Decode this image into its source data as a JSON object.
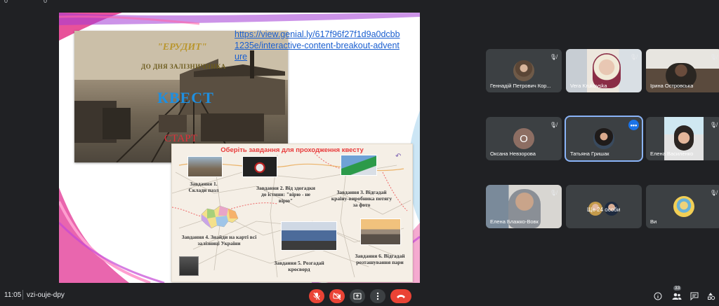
{
  "top": {
    "a": "0",
    "b": "0"
  },
  "slide": {
    "photo_title": "\"ЕРУДИТ\"",
    "photo_subtitle": "ДО ДНЯ ЗАЛІЗНИЧНИКА",
    "photo_quest": "КВЕСТ",
    "photo_start": "СТАРТ",
    "link": "https://view.genial.ly/617f96f27f1d9a0dcbb1235e/interactive-content-breakout-adventure",
    "map_title": "Оберіть завдання для проходження квесту",
    "tasks": [
      "Завдання 1. Склади пазл",
      "Завдання 2. Від здогадки до істини: \"вірю - не вірю\"",
      "Завдання 3. Відгадай країну-виробника потягу за фото",
      "Завдання 4. Знайди на карті всі залізниці України",
      "Завдання 5. Розгадай кросворд",
      "Завдання 6. Відгадай розташування пари"
    ]
  },
  "participants": [
    {
      "name": "Геннадій Петрович Кор...",
      "mic": "muted"
    },
    {
      "name": "Vera Krukovska",
      "mic": "muted"
    },
    {
      "name": "Ірина Островська",
      "mic": "muted"
    },
    {
      "name": "Оксана Невзорова",
      "initial": "О",
      "mic": "muted"
    },
    {
      "name": "Татьяна Гришак",
      "mic": "more"
    },
    {
      "name": "Елена Василенко",
      "mic": "muted"
    },
    {
      "name": "Елена Блажко-Вовк",
      "mic": "muted"
    },
    {
      "name": "Ще 24 особи"
    },
    {
      "name": "Ви",
      "mic": "muted"
    }
  ],
  "bottom": {
    "time": "11:05",
    "code": "vzi-ouje-dpy",
    "people_count": "33"
  },
  "colors": {
    "accent": "#ea4335",
    "bg": "#202124",
    "tile": "#3c4043",
    "active": "#8ab4f8"
  }
}
